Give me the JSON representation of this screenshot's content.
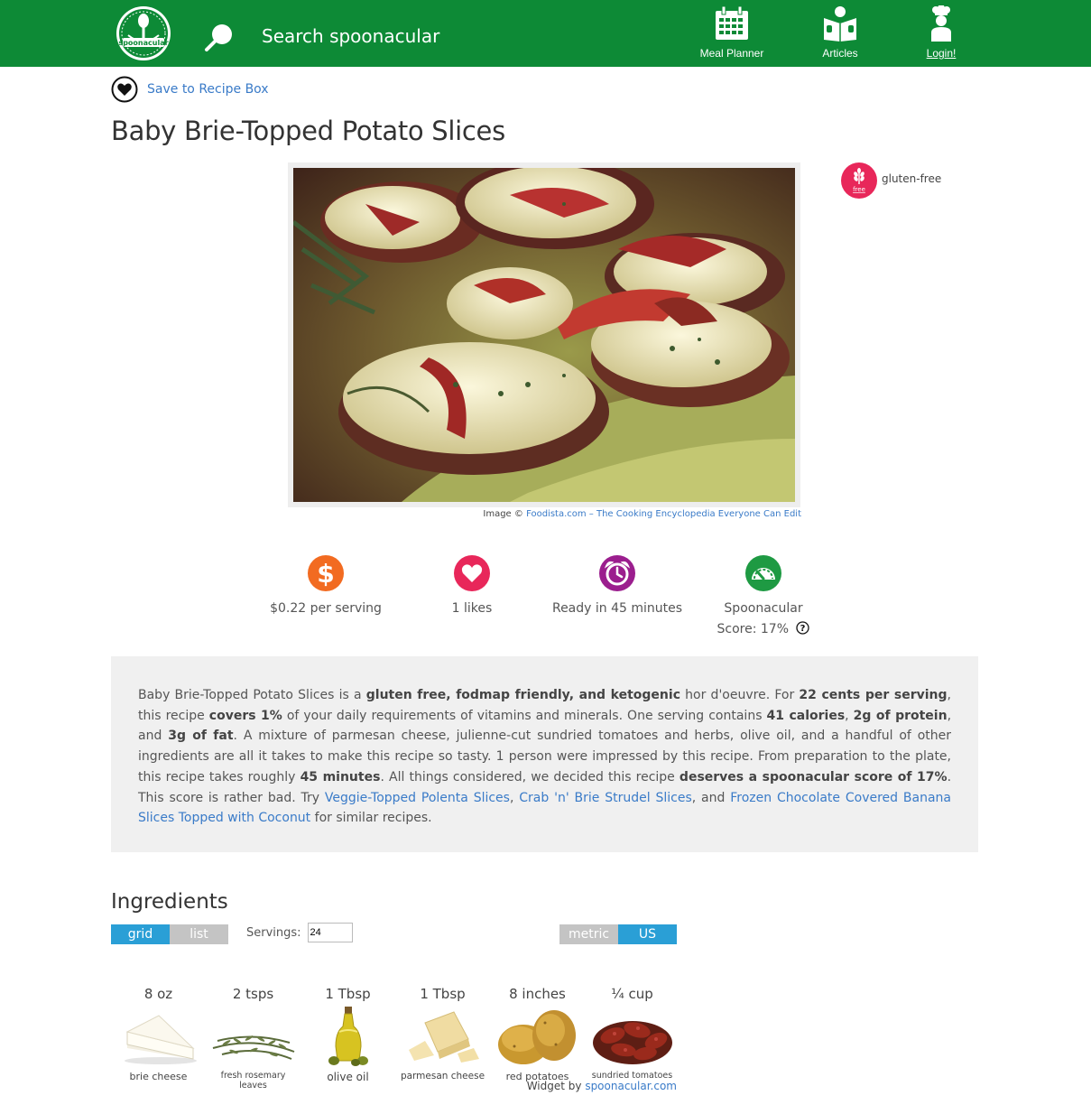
{
  "header": {
    "logo_text": "spoonacular",
    "search_placeholder": "Search spoonacular",
    "nav": [
      {
        "label": "Meal Planner",
        "icon": "calendar-icon"
      },
      {
        "label": "Articles",
        "icon": "book-reader-icon"
      },
      {
        "label": "Login!",
        "icon": "chef-icon"
      }
    ]
  },
  "save_label": "Save to Recipe Box",
  "title": "Baby Brie-Topped Potato Slices",
  "image_credit": {
    "prefix": "Image © ",
    "link": "Foodista.com – The Cooking Encyclopedia Everyone Can Edit"
  },
  "badge": {
    "icon_text": "free",
    "label": "gluten-free",
    "color": "#e8275a"
  },
  "stats": [
    {
      "icon": "dollar-icon",
      "color": "#f26b21",
      "line1": "$0.22 per serving",
      "line2": ""
    },
    {
      "icon": "heart-icon",
      "color": "#e8275a",
      "line1": "1 likes",
      "line2": ""
    },
    {
      "icon": "clock-icon",
      "color": "#9b1e8e",
      "line1": "Ready in 45 minutes",
      "line2": ""
    },
    {
      "icon": "gauge-icon",
      "color": "#1e9a43",
      "line1": "Spoonacular",
      "line2": "Score: 17%"
    }
  ],
  "summary": {
    "t1": "Baby Brie-Topped Potato Slices is a ",
    "b1": "gluten free, fodmap friendly, and ketogenic",
    "t2": " hor d'oeuvre. For ",
    "b2": "22 cents per serving",
    "t3": ", this recipe ",
    "b3": "covers 1%",
    "t4": " of your daily requirements of vitamins and minerals. One serving contains ",
    "b4": "41 calories",
    "t5": ", ",
    "b5": "2g of protein",
    "t6": ", and ",
    "b6": "3g of fat",
    "t7": ". A mixture of parmesan cheese, julienne-cut sundried tomatoes and herbs, olive oil, and a handful of other ingredients are all it takes to make this recipe so tasty. 1 person were impressed by this recipe. From preparation to the plate, this recipe takes roughly ",
    "b7": "45 minutes",
    "t8": ". All things considered, we decided this recipe ",
    "b8": "deserves a spoonacular score of 17%",
    "t9": ". This score is rather bad. Try ",
    "l1": "Veggie-Topped Polenta Slices",
    "t10": ", ",
    "l2": "Crab 'n' Brie Strudel Slices",
    "t11": ", and ",
    "l3": "Frozen Chocolate Covered Banana Slices Topped with Coconut",
    "t12": " for similar recipes."
  },
  "ingredients": {
    "title": "Ingredients",
    "view_grid": "grid",
    "view_list": "list",
    "servings_label": "Servings:",
    "servings_value": "24",
    "unit_metric": "metric",
    "unit_us": "US",
    "items": [
      {
        "amount": "8 oz",
        "name": "brie cheese"
      },
      {
        "amount": "2 tsps",
        "name": "fresh rosemary leaves"
      },
      {
        "amount": "1 Tbsp",
        "name": "olive oil"
      },
      {
        "amount": "1 Tbsp",
        "name": "parmesan cheese"
      },
      {
        "amount": "8 inches",
        "name": "red potatoes"
      },
      {
        "amount": "¼ cup",
        "name": "sundried tomatoes"
      }
    ],
    "widget_prefix": "Widget by ",
    "widget_link": "spoonacular.com"
  },
  "colors": {
    "header_green": "#0d8a36",
    "link_blue": "#3a7bc8",
    "toggle_blue": "#2a9fd6"
  }
}
